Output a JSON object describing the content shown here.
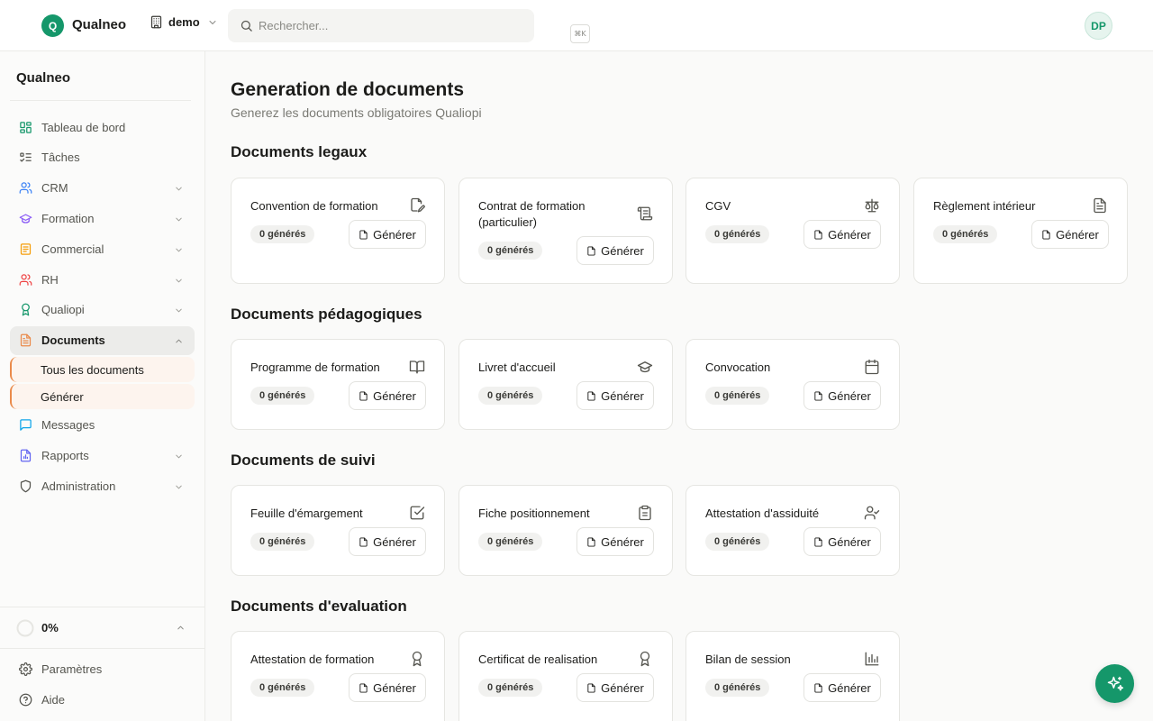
{
  "topbar": {
    "logo_letter": "Q",
    "brand": "Qualneo",
    "workspace": "demo",
    "search_placeholder": "Rechercher...",
    "search_shortcut": "⌘K",
    "avatar_initials": "DP"
  },
  "sidebar": {
    "title": "Qualneo",
    "items": [
      {
        "label": "Tableau de bord",
        "icon": "dashboard-icon"
      },
      {
        "label": "Tâches",
        "icon": "tasks-icon"
      },
      {
        "label": "CRM",
        "icon": "users-icon"
      },
      {
        "label": "Formation",
        "icon": "graduation-cap-icon"
      },
      {
        "label": "Commercial",
        "icon": "receipt-icon"
      },
      {
        "label": "RH",
        "icon": "people-icon"
      },
      {
        "label": "Qualiopi",
        "icon": "award-icon"
      },
      {
        "label": "Documents",
        "icon": "document-icon"
      },
      {
        "label": "Messages",
        "icon": "message-icon"
      },
      {
        "label": "Rapports",
        "icon": "report-icon"
      },
      {
        "label": "Administration",
        "icon": "shield-icon"
      }
    ],
    "sub_items": [
      {
        "label": "Tous les documents"
      },
      {
        "label": "Générer"
      }
    ],
    "progress_label": "0%",
    "progress_value": 0,
    "footer": [
      {
        "label": "Paramètres",
        "icon": "gear-icon"
      },
      {
        "label": "Aide",
        "icon": "help-icon"
      }
    ],
    "colors": {
      "dashboard": "#15976a",
      "tasks": "#55554f",
      "crm": "#3b82f6",
      "formation": "#8b5cf6",
      "commercial": "#f59e0b",
      "rh": "#ef4444",
      "qualiopi": "#15976a",
      "documents": "#ea8a4a",
      "messages": "#0ea5e9",
      "rapports": "#6366f1",
      "admin": "#55554f"
    }
  },
  "main": {
    "title": "Generation de documents",
    "subtitle": "Generez les documents obligatoires Qualiopi",
    "button_label": "Générer",
    "sections": [
      {
        "title": "Documents legaux",
        "cards": [
          {
            "title": "Convention de formation",
            "count": "0 générés",
            "icon": "file-pen-icon"
          },
          {
            "title": "Contrat de formation (particulier)",
            "count": "0 générés",
            "icon": "scroll-icon"
          },
          {
            "title": "CGV",
            "count": "0 générés",
            "icon": "scale-icon"
          },
          {
            "title": "Règlement intérieur",
            "count": "0 générés",
            "icon": "file-text-icon"
          }
        ]
      },
      {
        "title": "Documents pédagogiques",
        "cards": [
          {
            "title": "Programme de formation",
            "count": "0 générés",
            "icon": "book-open-icon"
          },
          {
            "title": "Livret d'accueil",
            "count": "0 générés",
            "icon": "graduation-cap-icon"
          },
          {
            "title": "Convocation",
            "count": "0 générés",
            "icon": "calendar-icon"
          }
        ]
      },
      {
        "title": "Documents de suivi",
        "cards": [
          {
            "title": "Feuille d'émargement",
            "count": "0 générés",
            "icon": "checkbox-icon"
          },
          {
            "title": "Fiche positionnement",
            "count": "0 générés",
            "icon": "clipboard-icon"
          },
          {
            "title": "Attestation d'assiduité",
            "count": "0 générés",
            "icon": "user-check-icon"
          }
        ]
      },
      {
        "title": "Documents d'evaluation",
        "cards": [
          {
            "title": "Attestation de formation",
            "count": "0 générés",
            "icon": "award-icon"
          },
          {
            "title": "Certificat de realisation",
            "count": "0 générés",
            "icon": "award-icon"
          },
          {
            "title": "Bilan de session",
            "count": "0 générés",
            "icon": "bar-chart-icon"
          }
        ]
      }
    ]
  },
  "accent_color": "#15976a"
}
